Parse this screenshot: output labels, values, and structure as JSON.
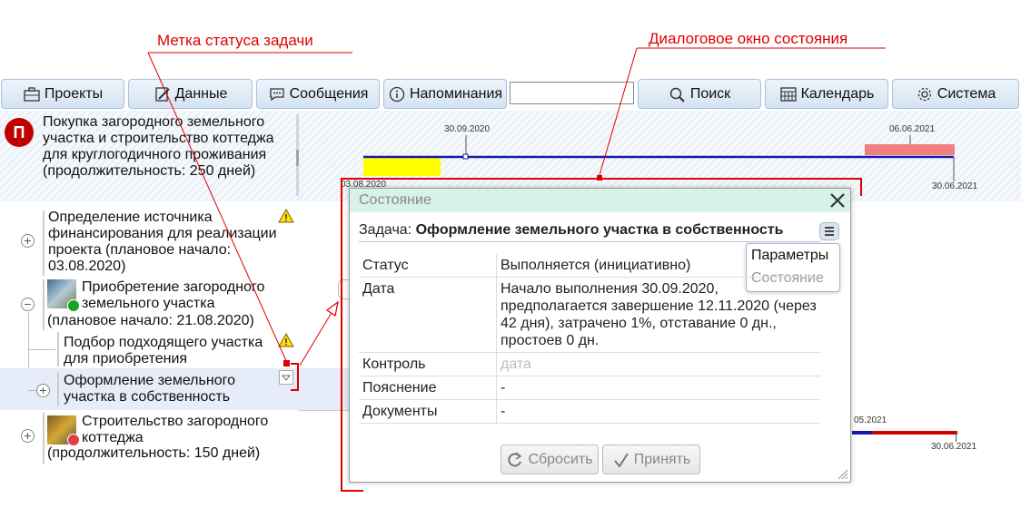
{
  "annotations": {
    "status_label": "Метка статуса задачи",
    "dialog_label": "Диалоговое окно состояния"
  },
  "toolbar": {
    "projects": "Проекты",
    "data": "Данные",
    "messages": "Сообщения",
    "reminders": "Напоминания",
    "search_value": "",
    "search": "Поиск",
    "calendar": "Календарь",
    "system": "Система"
  },
  "project": {
    "badge": "П",
    "title": "Покупка загородного земельного участка и строительство коттеджа для круглогодичного проживания (продолжительность: 250 дней)",
    "dates": {
      "start": "30.09.2020",
      "end": "06.06.2021",
      "finish": "30.06.2021",
      "left": "03.08.2020"
    }
  },
  "tasks": [
    {
      "title": "Определение источника финансирования для реализации проекта (плановое начало: 03.08.2020)"
    },
    {
      "title": "Приобретение загородного земельного участка",
      "sub": "(плановое начало: 21.08.2020)"
    },
    {
      "title": "Подбор подходящего участка для приобретения"
    },
    {
      "title": "Оформление земельного участка в собственность"
    },
    {
      "title": "Строительство загородного коттеджа",
      "sub": "(продолжительность: 150 дней)"
    }
  ],
  "gantt_bottom": {
    "date1": "05.2021",
    "date2": "30.06.2021"
  },
  "dialog": {
    "title": "Состояние",
    "task_label": "Задача:",
    "task_name": "Оформление земельного участка в собственность",
    "menu": [
      "Параметры",
      "Состояние"
    ],
    "rows": [
      {
        "key": "Статус",
        "value": "Выполняется (инициативно)"
      },
      {
        "key": "Дата",
        "value": "Начало выполнения 30.09.2020, предполагается завершение 12.11.2020 (через 42 дня), затрачено 1%, отставание 0 дн., простоев 0 дн."
      },
      {
        "key": "Контроль",
        "placeholder": "дата"
      },
      {
        "key": "Пояснение",
        "value": "-"
      },
      {
        "key": "Документы",
        "value": "-"
      }
    ],
    "reset": "Сбросить",
    "accept": "Принять"
  },
  "colors": {
    "annotation": "#e00000",
    "dialog_header": "#d7f2e6",
    "gantt_blue": "#1a1aa8",
    "gantt_yellow": "#ffff00",
    "gantt_pink": "#f08080",
    "gantt_red": "#d00000"
  }
}
